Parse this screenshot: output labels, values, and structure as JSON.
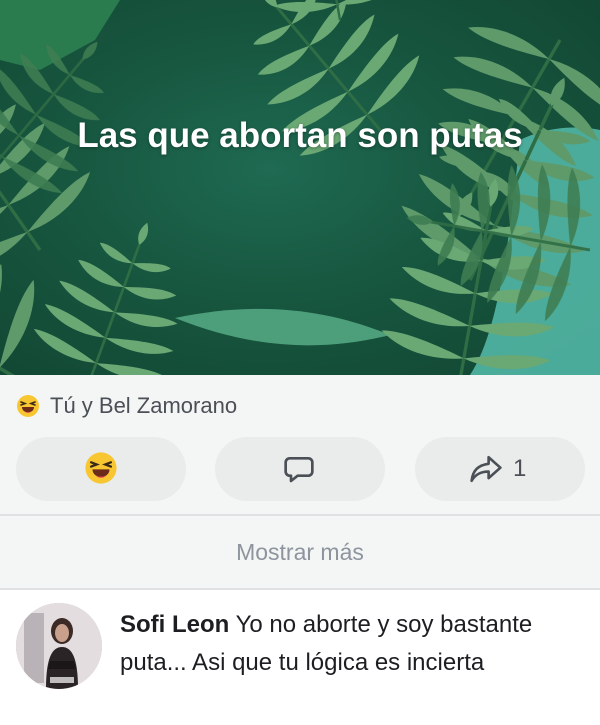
{
  "post": {
    "text": "Las que abortan son putas",
    "colors": {
      "background": "#17563f",
      "leaf_light": "#5e9a6a",
      "leaf_mid": "#3f7d52",
      "accent_teal": "#4fb1a0"
    }
  },
  "reactions": {
    "emoji_icon": "haha-reaction-icon",
    "names": "Tú y Bel Zamorano"
  },
  "actions": {
    "react_icon": "haha-reaction-icon",
    "comment_icon": "comment-bubble-icon",
    "share_icon": "share-arrow-icon",
    "share_count": "1"
  },
  "show_more": {
    "label": "Mostrar más"
  },
  "comment": {
    "author": "Sofi Leon",
    "text": " Yo no aborte y soy bastante puta... Asi que tu lógica es incierta"
  }
}
